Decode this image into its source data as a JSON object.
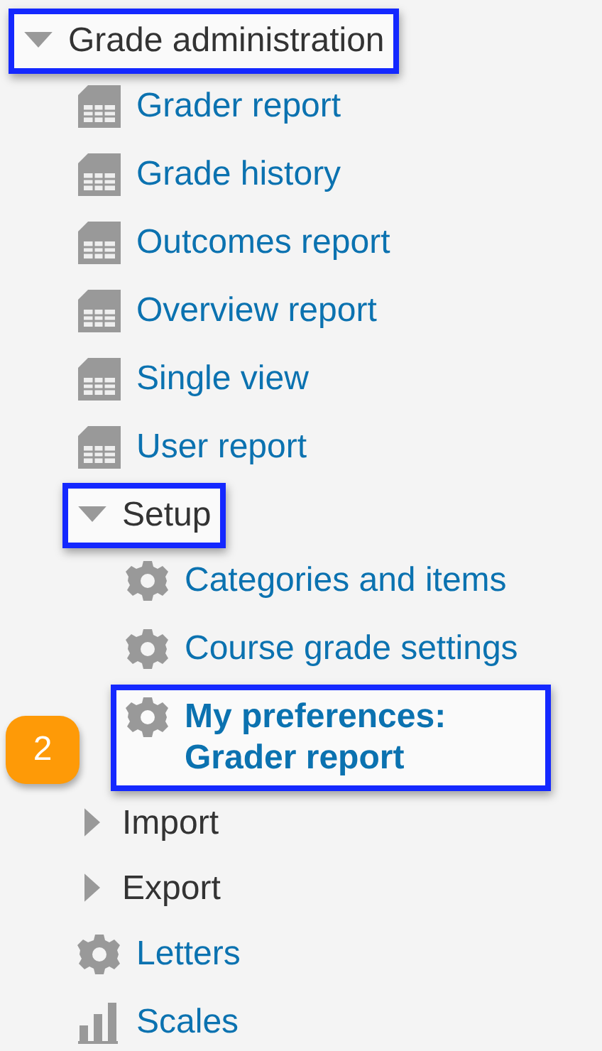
{
  "tree": [
    {
      "label": "Grade administration",
      "kind": "branch",
      "expanded": true,
      "highlighted": true,
      "children": [
        {
          "label": "Grader report",
          "kind": "report"
        },
        {
          "label": "Grade history",
          "kind": "report"
        },
        {
          "label": "Outcomes report",
          "kind": "report"
        },
        {
          "label": "Overview report",
          "kind": "report"
        },
        {
          "label": "Single view",
          "kind": "report"
        },
        {
          "label": "User report",
          "kind": "report"
        },
        {
          "label": "Setup",
          "kind": "branch",
          "expanded": true,
          "highlighted": true,
          "children": [
            {
              "label": "Categories and items",
              "kind": "setting"
            },
            {
              "label": "Course grade settings",
              "kind": "setting"
            },
            {
              "label": "My preferences: Grader report",
              "kind": "setting",
              "highlighted": true,
              "badge": "2"
            }
          ]
        },
        {
          "label": "Import",
          "kind": "branch",
          "expanded": false
        },
        {
          "label": "Export",
          "kind": "branch",
          "expanded": false
        },
        {
          "label": "Letters",
          "kind": "setting"
        },
        {
          "label": "Scales",
          "kind": "scale"
        }
      ]
    }
  ]
}
